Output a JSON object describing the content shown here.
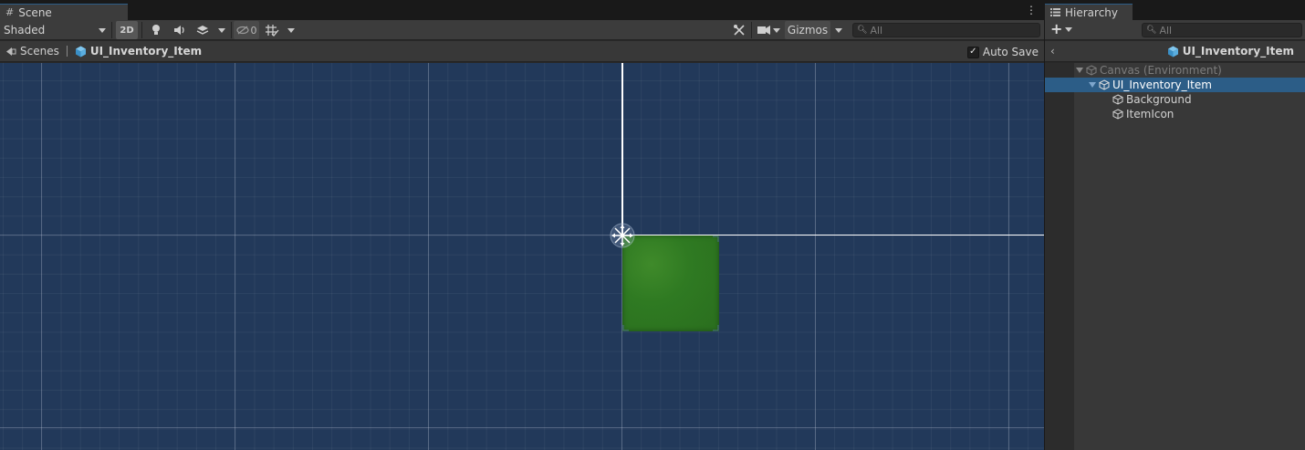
{
  "scene": {
    "tab_label": "Scene",
    "shading_mode": "Shaded",
    "mode_2d_label": "2D",
    "hidden_count": "0",
    "gizmos_label": "Gizmos",
    "search_placeholder": "All",
    "breadcrumb": {
      "root_label": "Scenes",
      "prefab_label": "UI_Inventory_Item"
    },
    "auto_save_label": "Auto Save",
    "auto_save_checked": true,
    "colors": {
      "viewport_bg": "#22395a",
      "selected_object": "#2f7a22",
      "accent": "#2c5d87"
    }
  },
  "hierarchy": {
    "tab_label": "Hierarchy",
    "search_placeholder": "All",
    "header_title": "UI_Inventory_Item",
    "items": [
      {
        "label": "Canvas (Environment)",
        "expanded": true,
        "dimmed": true
      },
      {
        "label": "UI_Inventory_Item",
        "expanded": true,
        "selected": true
      },
      {
        "label": "Background"
      },
      {
        "label": "ItemIcon"
      }
    ]
  }
}
